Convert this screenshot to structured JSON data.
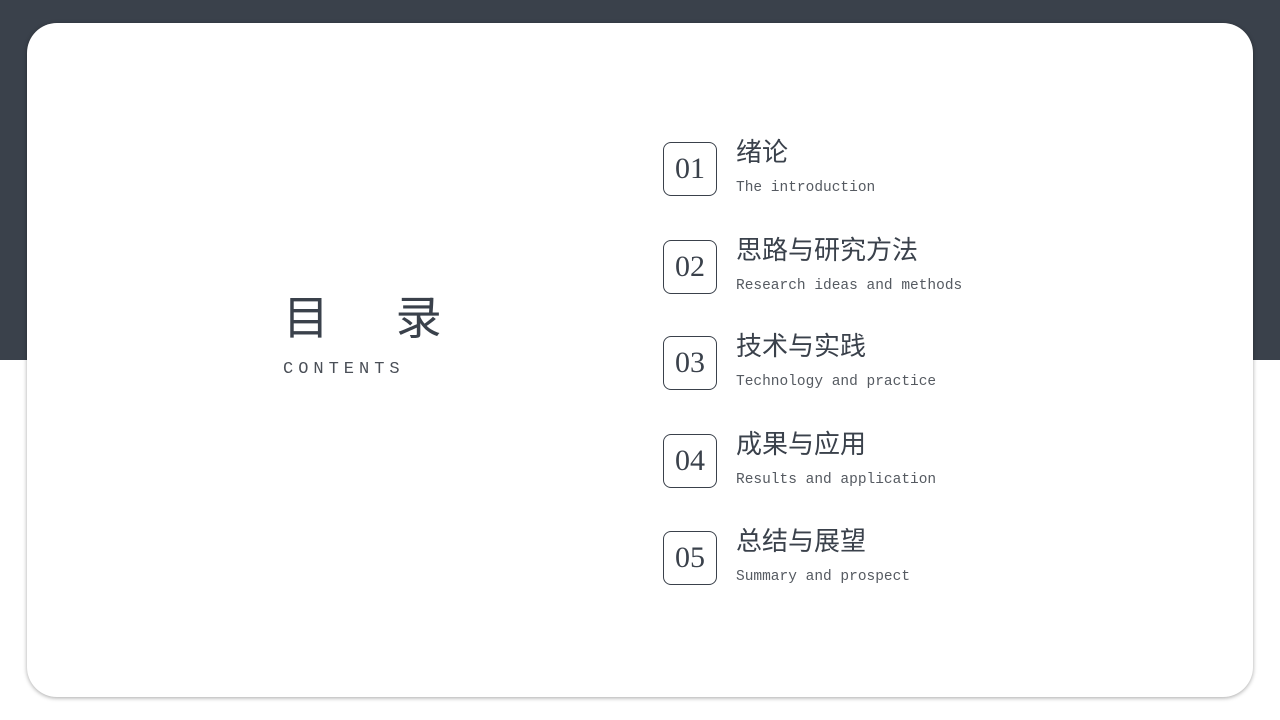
{
  "title": {
    "main": "目 录",
    "sub": "CONTENTS"
  },
  "items": [
    {
      "number": "01",
      "title": "绪论",
      "subtitle": "The introduction"
    },
    {
      "number": "02",
      "title": "思路与研究方法",
      "subtitle": "Research ideas and methods"
    },
    {
      "number": "03",
      "title": "技术与实践",
      "subtitle": "Technology and practice"
    },
    {
      "number": "04",
      "title": "成果与应用",
      "subtitle": "Results and application"
    },
    {
      "number": "05",
      "title": "总结与展望",
      "subtitle": "Summary and prospect"
    }
  ],
  "colors": {
    "band": "#3a414b",
    "text": "#3a414b",
    "card": "#ffffff"
  }
}
